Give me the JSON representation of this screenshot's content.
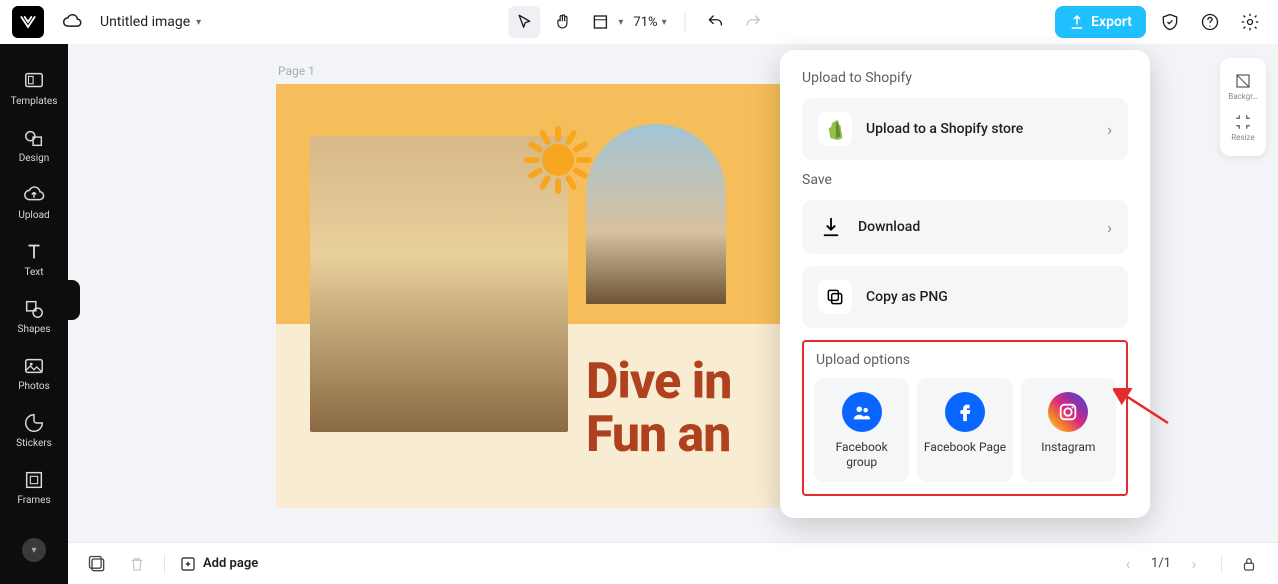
{
  "topbar": {
    "doc_title": "Untitled image",
    "zoom": "71%",
    "export_label": "Export"
  },
  "sidebar": {
    "items": [
      {
        "label": "Templates"
      },
      {
        "label": "Design"
      },
      {
        "label": "Upload"
      },
      {
        "label": "Text"
      },
      {
        "label": "Shapes"
      },
      {
        "label": "Photos"
      },
      {
        "label": "Stickers"
      },
      {
        "label": "Frames"
      }
    ]
  },
  "right_tools": {
    "items": [
      {
        "label": "Backgr…"
      },
      {
        "label": "Resize"
      }
    ]
  },
  "canvas": {
    "page_label": "Page 1",
    "headline_1": "Dive in",
    "headline_2": "Fun an"
  },
  "export_panel": {
    "shopify_section": "Upload to Shopify",
    "shopify_button": "Upload to a Shopify store",
    "save_section": "Save",
    "download_label": "Download",
    "copy_label": "Copy as PNG",
    "upload_options_title": "Upload options",
    "options": [
      {
        "label": "Facebook group"
      },
      {
        "label": "Facebook Page"
      },
      {
        "label": "Instagram"
      }
    ]
  },
  "bottombar": {
    "add_page": "Add page",
    "page_indicator": "1/1"
  }
}
